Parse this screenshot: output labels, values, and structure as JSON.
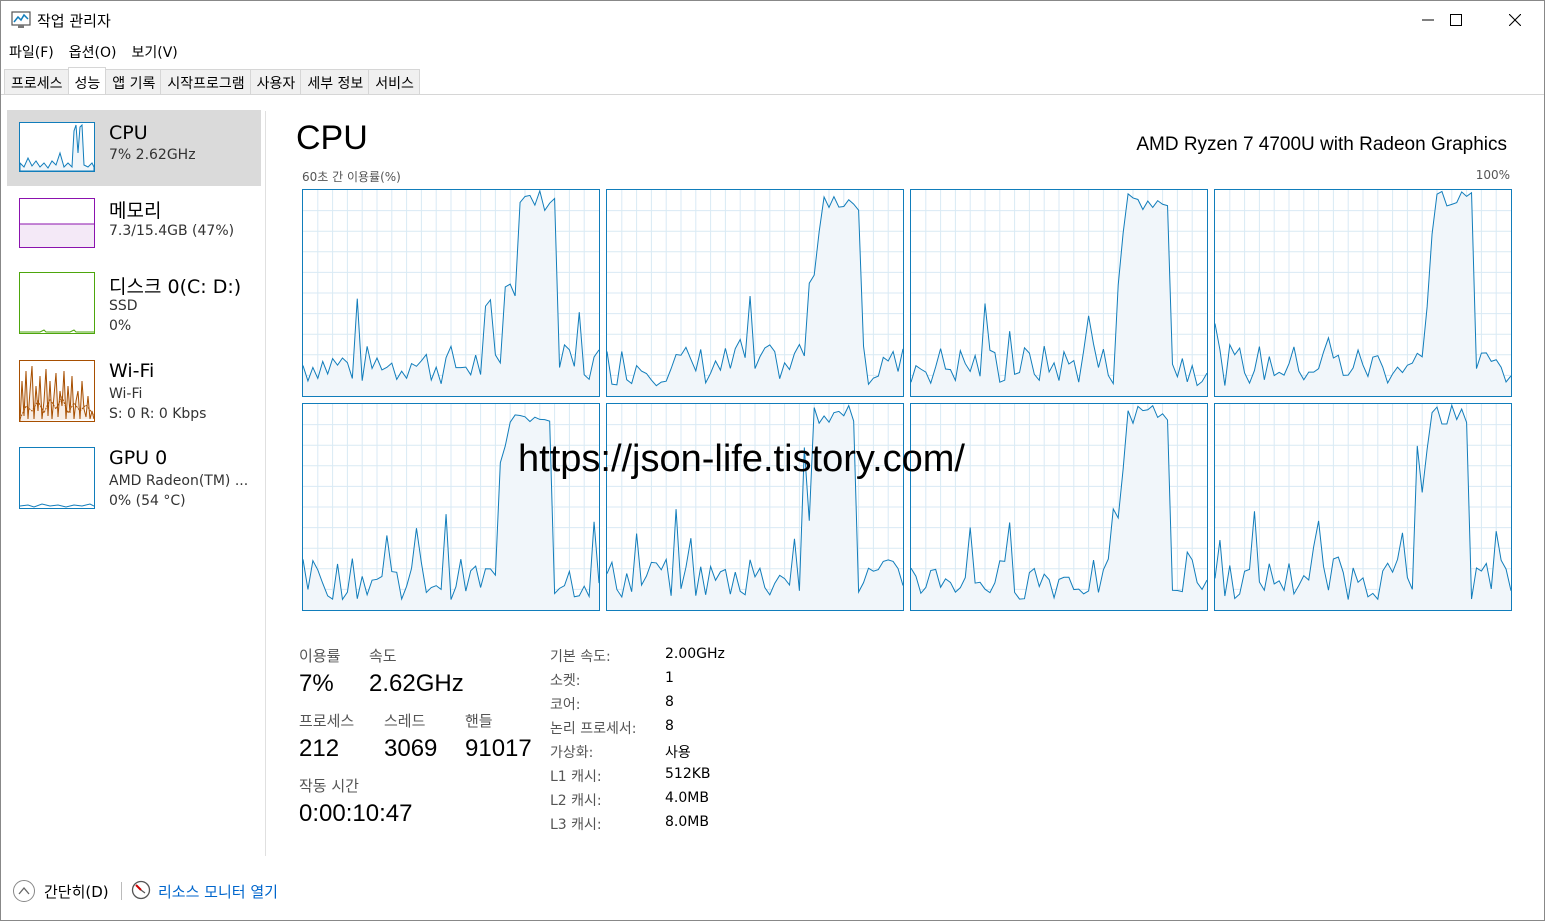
{
  "window": {
    "title": "작업 관리자",
    "icon": "task-manager-icon",
    "controls": [
      "minimize-icon",
      "maximize-icon",
      "close-icon"
    ]
  },
  "menu": {
    "file": "파일(F)",
    "options": "옵션(O)",
    "view": "보기(V)"
  },
  "tabs": [
    "프로세스",
    "성능",
    "앱 기록",
    "시작프로그램",
    "사용자",
    "세부 정보",
    "서비스"
  ],
  "active_tab": "성능",
  "sidebar": {
    "cpu": {
      "title": "CPU",
      "line1": "7% 2.62GHz",
      "color": "#117dbb"
    },
    "memory": {
      "title": "메모리",
      "line1": "7.3/15.4GB (47%)",
      "color": "#8b12ae"
    },
    "disk": {
      "title": "디스크 0(C: D:)",
      "line1": "SSD",
      "line2": "0%",
      "color": "#4da60c"
    },
    "wifi": {
      "title": "Wi-Fi",
      "line1": "Wi-Fi",
      "line2": "S: 0 R: 0 Kbps",
      "color": "#a74f01"
    },
    "gpu": {
      "title": "GPU 0",
      "line1": "AMD Radeon(TM) ...",
      "line2": "0% (54 °C)",
      "color": "#117dbb"
    }
  },
  "main": {
    "title": "CPU",
    "cpu_model": "AMD Ryzen 7 4700U with Radeon Graphics",
    "axis_left": "60초 간 이용률(%)",
    "axis_right": "100%",
    "graph_color": "#117dbb",
    "graph_fill": "#f1f6fa",
    "grid_color": "#d9eaf4",
    "logical_processor_count": 8
  },
  "stats": {
    "utilization_label": "이용률",
    "utilization_value": "7%",
    "speed_label": "속도",
    "speed_value": "2.62GHz",
    "processes_label": "프로세스",
    "processes_value": "212",
    "threads_label": "스레드",
    "threads_value": "3069",
    "handles_label": "핸들",
    "handles_value": "91017",
    "uptime_label": "작동 시간",
    "uptime_value": "0:00:10:47"
  },
  "info": [
    {
      "key": "기본 속도:",
      "value": "2.00GHz"
    },
    {
      "key": "소켓:",
      "value": "1"
    },
    {
      "key": "코어:",
      "value": "8"
    },
    {
      "key": "논리 프로세서:",
      "value": "8"
    },
    {
      "key": "가상화:",
      "value": "사용"
    },
    {
      "key": "L1 캐시:",
      "value": "512KB"
    },
    {
      "key": "L2 캐시:",
      "value": "4.0MB"
    },
    {
      "key": "L3 캐시:",
      "value": "8.0MB"
    }
  ],
  "watermark": "https://json-life.tistory.com/",
  "footer": {
    "fewer_details": "간단히(D)",
    "resource_monitor": "리소스 모니터 열기"
  }
}
